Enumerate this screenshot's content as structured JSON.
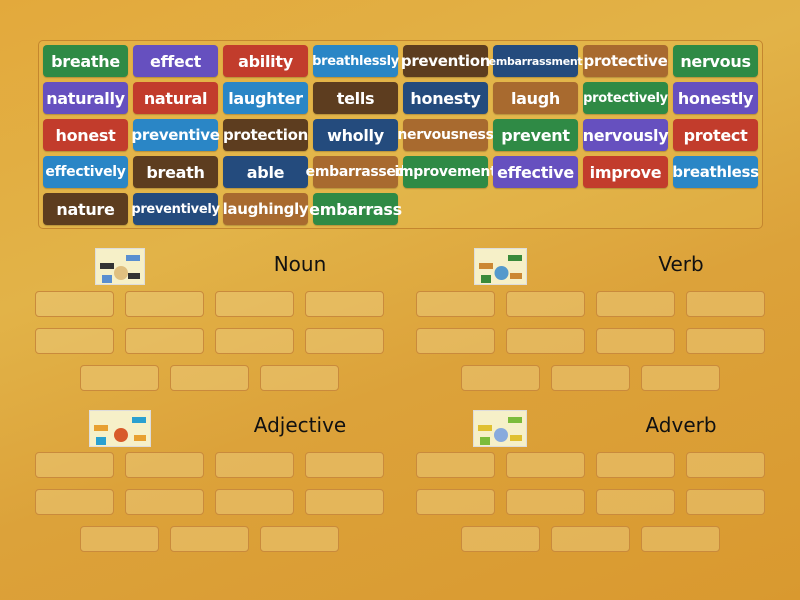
{
  "colors": {
    "green": "#2f8a45",
    "purple": "#6650bf",
    "red": "#c23c2c",
    "blue": "#2a86c6",
    "brown": "#5d3d1f",
    "darkblue": "#244b7d",
    "tan": "#a86a2f"
  },
  "tiles": [
    {
      "label": "breathe",
      "color": "green"
    },
    {
      "label": "effect",
      "color": "purple"
    },
    {
      "label": "ability",
      "color": "red"
    },
    {
      "label": "breathlessly",
      "color": "blue"
    },
    {
      "label": "prevention",
      "color": "brown"
    },
    {
      "label": "embarrassment",
      "color": "darkblue"
    },
    {
      "label": "protective",
      "color": "tan"
    },
    {
      "label": "nervous",
      "color": "green"
    },
    {
      "label": "naturally",
      "color": "purple"
    },
    {
      "label": "natural",
      "color": "red"
    },
    {
      "label": "laughter",
      "color": "blue"
    },
    {
      "label": "tells",
      "color": "brown"
    },
    {
      "label": "honesty",
      "color": "darkblue"
    },
    {
      "label": "laugh",
      "color": "tan"
    },
    {
      "label": "protectively",
      "color": "green"
    },
    {
      "label": "honestly",
      "color": "purple"
    },
    {
      "label": "honest",
      "color": "red"
    },
    {
      "label": "preventive",
      "color": "blue"
    },
    {
      "label": "protection",
      "color": "brown"
    },
    {
      "label": "wholly",
      "color": "darkblue"
    },
    {
      "label": "nervousness",
      "color": "tan"
    },
    {
      "label": "prevent",
      "color": "green"
    },
    {
      "label": "nervously",
      "color": "purple"
    },
    {
      "label": "protect",
      "color": "red"
    },
    {
      "label": "effectively",
      "color": "blue"
    },
    {
      "label": "breath",
      "color": "brown"
    },
    {
      "label": "able",
      "color": "darkblue"
    },
    {
      "label": "embarrassed",
      "color": "tan"
    },
    {
      "label": "improvement",
      "color": "green"
    },
    {
      "label": "effective",
      "color": "purple"
    },
    {
      "label": "improve",
      "color": "red"
    },
    {
      "label": "breathless",
      "color": "blue"
    },
    {
      "label": "nature",
      "color": "brown"
    },
    {
      "label": "preventively",
      "color": "darkblue"
    },
    {
      "label": "laughingly",
      "color": "tan"
    },
    {
      "label": "embarrass",
      "color": "green"
    }
  ],
  "groups": [
    {
      "title": "Noun",
      "slots": 11
    },
    {
      "title": "Verb",
      "slots": 11
    },
    {
      "title": "Adjective",
      "slots": 11
    },
    {
      "title": "Adverb",
      "slots": 11
    }
  ]
}
